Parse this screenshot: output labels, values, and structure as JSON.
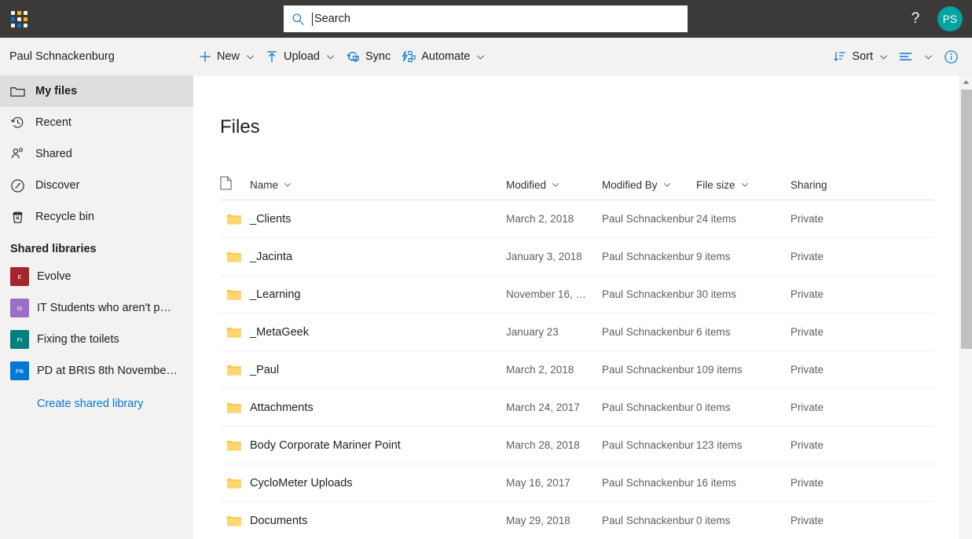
{
  "header": {
    "waffle_icon": "app-launcher-icon",
    "search": {
      "placeholder": "Search",
      "value": "",
      "icon": "search-icon"
    },
    "help_label": "?",
    "avatar_initials": "PS",
    "avatar_color": "#03a3a3",
    "background": "#3b3a39"
  },
  "commandbar": {
    "owner": "Paul Schnackenburg",
    "items": [
      {
        "label": "New",
        "icon": "plus-icon",
        "chevron": true
      },
      {
        "label": "Upload",
        "icon": "upload-arrow-icon",
        "chevron": true
      },
      {
        "label": "Sync",
        "icon": "sync-icon",
        "chevron": false
      },
      {
        "label": "Automate",
        "icon": "automate-flow-icon",
        "chevron": true
      }
    ],
    "right_items": [
      {
        "label": "Sort",
        "icon": "sort-icon",
        "chevron": true
      },
      {
        "label": "",
        "icon": "view-list-icon",
        "chevron": true
      },
      {
        "label": "",
        "icon": "info-circle-icon",
        "chevron": false
      }
    ],
    "accent": "#0078d4"
  },
  "sidebar": {
    "nav": [
      {
        "label": "My files",
        "icon": "folder-icon",
        "selected": true
      },
      {
        "label": "Recent",
        "icon": "clock-history-icon",
        "selected": false
      },
      {
        "label": "Shared",
        "icon": "people-icon",
        "selected": false
      },
      {
        "label": "Discover",
        "icon": "compass-icon",
        "selected": false
      },
      {
        "label": "Recycle bin",
        "icon": "trash-icon",
        "selected": false
      }
    ],
    "libraries_title": "Shared libraries",
    "libraries": [
      {
        "label": "Evolve",
        "initials": "E",
        "color": "#a4262c"
      },
      {
        "label": "IT Students who aren't p…",
        "initials": "IS",
        "color": "#9b6dc6"
      },
      {
        "label": "Fixing the toilets",
        "initials": "Ft",
        "color": "#00807e"
      },
      {
        "label": "PD at BRIS 8th Novembe…",
        "initials": "PB",
        "color": "#0078d4"
      }
    ],
    "create_library_label": "Create shared library"
  },
  "main": {
    "title": "Files",
    "columns": [
      {
        "label": "",
        "icon": "document-icon",
        "chevron": false
      },
      {
        "label": "Name",
        "chevron": true
      },
      {
        "label": "Modified",
        "chevron": true
      },
      {
        "label": "Modified By",
        "chevron": true
      },
      {
        "label": "File size",
        "chevron": true
      },
      {
        "label": "Sharing",
        "chevron": false
      }
    ],
    "rows": [
      {
        "name": "_Clients",
        "modified": "March 2, 2018",
        "modified_by": "Paul Schnackenbur",
        "size": "24 items",
        "sharing": "Private",
        "icon": "folder-icon"
      },
      {
        "name": "_Jacinta",
        "modified": "January 3, 2018",
        "modified_by": "Paul Schnackenbur",
        "size": "9 items",
        "sharing": "Private",
        "icon": "folder-icon"
      },
      {
        "name": "_Learning",
        "modified": "November 16, …",
        "modified_by": "Paul Schnackenbur",
        "size": "30 items",
        "sharing": "Private",
        "icon": "folder-icon"
      },
      {
        "name": "_MetaGeek",
        "modified": "January 23",
        "modified_by": "Paul Schnackenbur",
        "size": "6 items",
        "sharing": "Private",
        "icon": "folder-icon"
      },
      {
        "name": "_Paul",
        "modified": "March 2, 2018",
        "modified_by": "Paul Schnackenbur",
        "size": "109 items",
        "sharing": "Private",
        "icon": "folder-icon"
      },
      {
        "name": "Attachments",
        "modified": "March 24, 2017",
        "modified_by": "Paul Schnackenbur",
        "size": "0 items",
        "sharing": "Private",
        "icon": "folder-icon"
      },
      {
        "name": "Body Corporate Mariner Point",
        "modified": "March 28, 2018",
        "modified_by": "Paul Schnackenbur",
        "size": "123 items",
        "sharing": "Private",
        "icon": "folder-icon"
      },
      {
        "name": "CycloMeter Uploads",
        "modified": "May 16, 2017",
        "modified_by": "Paul Schnackenbur",
        "size": "16 items",
        "sharing": "Private",
        "icon": "folder-icon"
      },
      {
        "name": "Documents",
        "modified": "May 29, 2018",
        "modified_by": "Paul Schnackenbur",
        "size": "0 items",
        "sharing": "Private",
        "icon": "folder-icon"
      }
    ]
  }
}
